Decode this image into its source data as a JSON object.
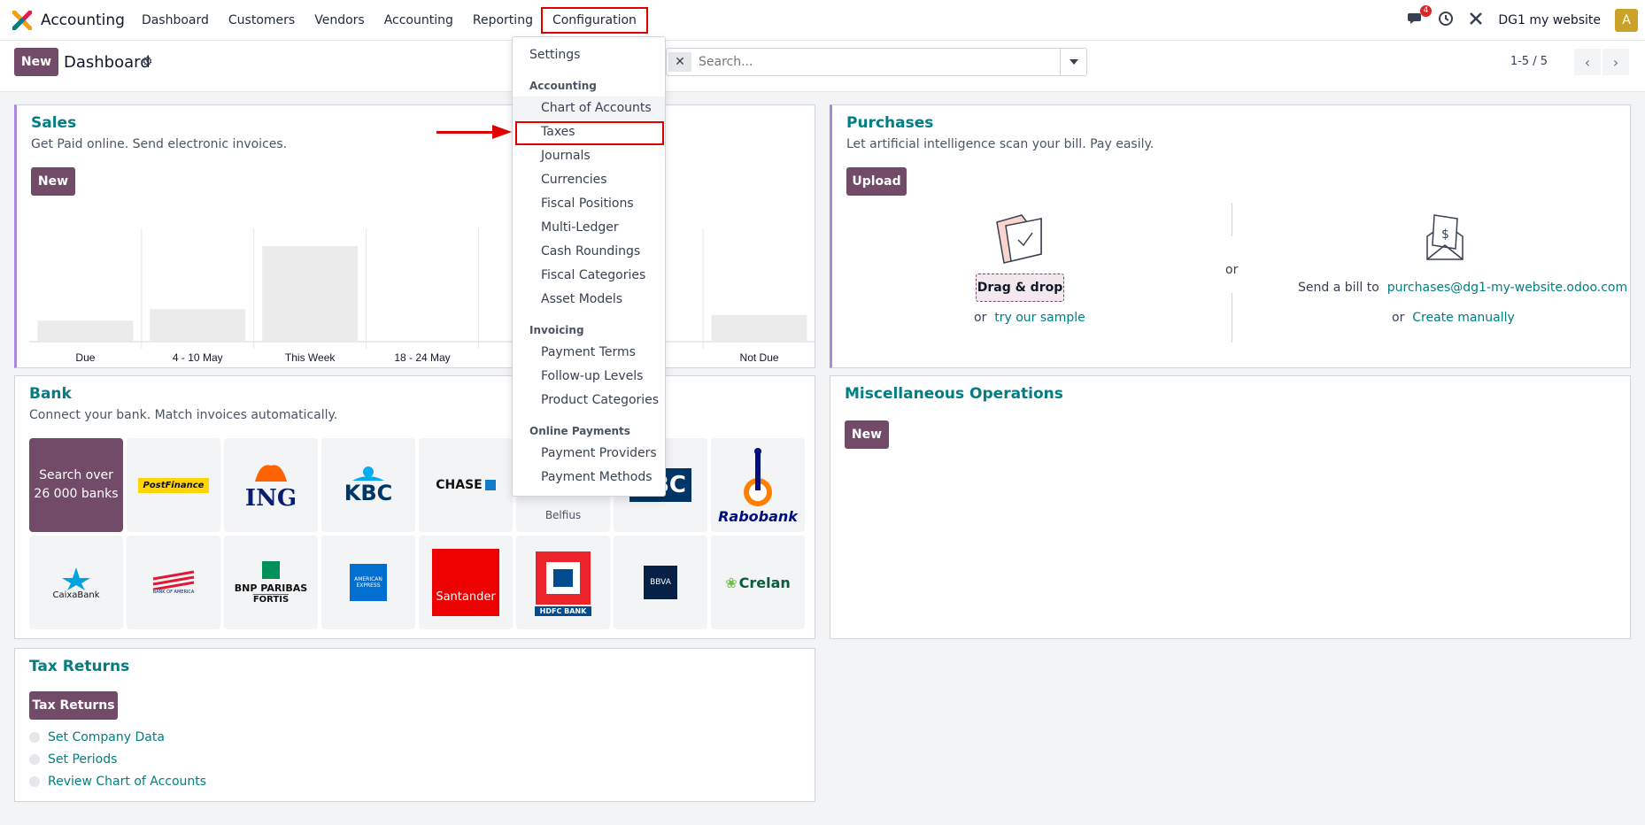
{
  "app": {
    "name": "Accounting"
  },
  "menu": [
    {
      "label": "Dashboard"
    },
    {
      "label": "Customers"
    },
    {
      "label": "Vendors"
    },
    {
      "label": "Accounting"
    },
    {
      "label": "Reporting"
    },
    {
      "label": "Configuration"
    }
  ],
  "topright": {
    "messages_count": "4",
    "company": "DG1 my website",
    "avatar_initial": "A"
  },
  "control": {
    "new_label": "New",
    "breadcrumb": "Dashboard",
    "search_placeholder": "Search...",
    "pager": "1-5 / 5"
  },
  "sales": {
    "title": "Sales",
    "subtitle": "Get Paid online. Send electronic invoices.",
    "new_label": "New",
    "chart_data": {
      "type": "bar",
      "categories": [
        "Due",
        "4 - 10 May",
        "This Week",
        "18 - 24 May",
        "",
        "",
        "Not Due"
      ],
      "values": [
        22,
        34,
        100,
        0,
        0,
        0,
        28
      ],
      "title": "",
      "xlabel": "",
      "ylabel": "",
      "ylim": [
        0,
        100
      ]
    }
  },
  "purchases": {
    "title": "Purchases",
    "subtitle": "Let artificial intelligence scan your bill. Pay easily.",
    "upload_label": "Upload",
    "drag_drop": "Drag & drop",
    "or1": "or",
    "try_sample": "try our sample",
    "or_mid": "or",
    "send_bill": "Send a bill to",
    "email": "purchases@dg1-my-website.odoo.com",
    "or2": "or",
    "create_manually": "Create manually"
  },
  "bank": {
    "title": "Bank",
    "subtitle": "Connect your bank. Match invoices automatically.",
    "search_line1": "Search over",
    "search_line2": "26 000 banks",
    "logos": [
      "PostFinance",
      "ING",
      "KBC",
      "CHASE",
      "Belfius",
      "CBC",
      "Rabobank",
      "CaixaBank",
      "BANK OF AMERICA",
      "BNP PARIBAS",
      "FORTIS",
      "AMERICAN EXPRESS",
      "Santander",
      "HDFC BANK",
      "BBVA",
      "Crelan"
    ]
  },
  "misc": {
    "title": "Miscellaneous Operations",
    "new_label": "New"
  },
  "tax": {
    "title": "Tax Returns",
    "button": "Tax Returns",
    "steps": [
      "Set Company Data",
      "Set Periods",
      "Review Chart of Accounts"
    ]
  },
  "dropdown": {
    "settings": "Settings",
    "accounting_header": "Accounting",
    "accounting_items": [
      "Chart of Accounts",
      "Taxes",
      "Journals",
      "Currencies",
      "Fiscal Positions",
      "Multi-Ledger",
      "Cash Roundings",
      "Fiscal Categories",
      "Asset Models"
    ],
    "invoicing_header": "Invoicing",
    "invoicing_items": [
      "Payment Terms",
      "Follow-up Levels",
      "Product Categories"
    ],
    "online_header": "Online Payments",
    "online_items": [
      "Payment Providers",
      "Payment Methods"
    ]
  },
  "colors": {
    "brand": "#714b67",
    "teal": "#017e84",
    "highlight": "#e00000"
  }
}
